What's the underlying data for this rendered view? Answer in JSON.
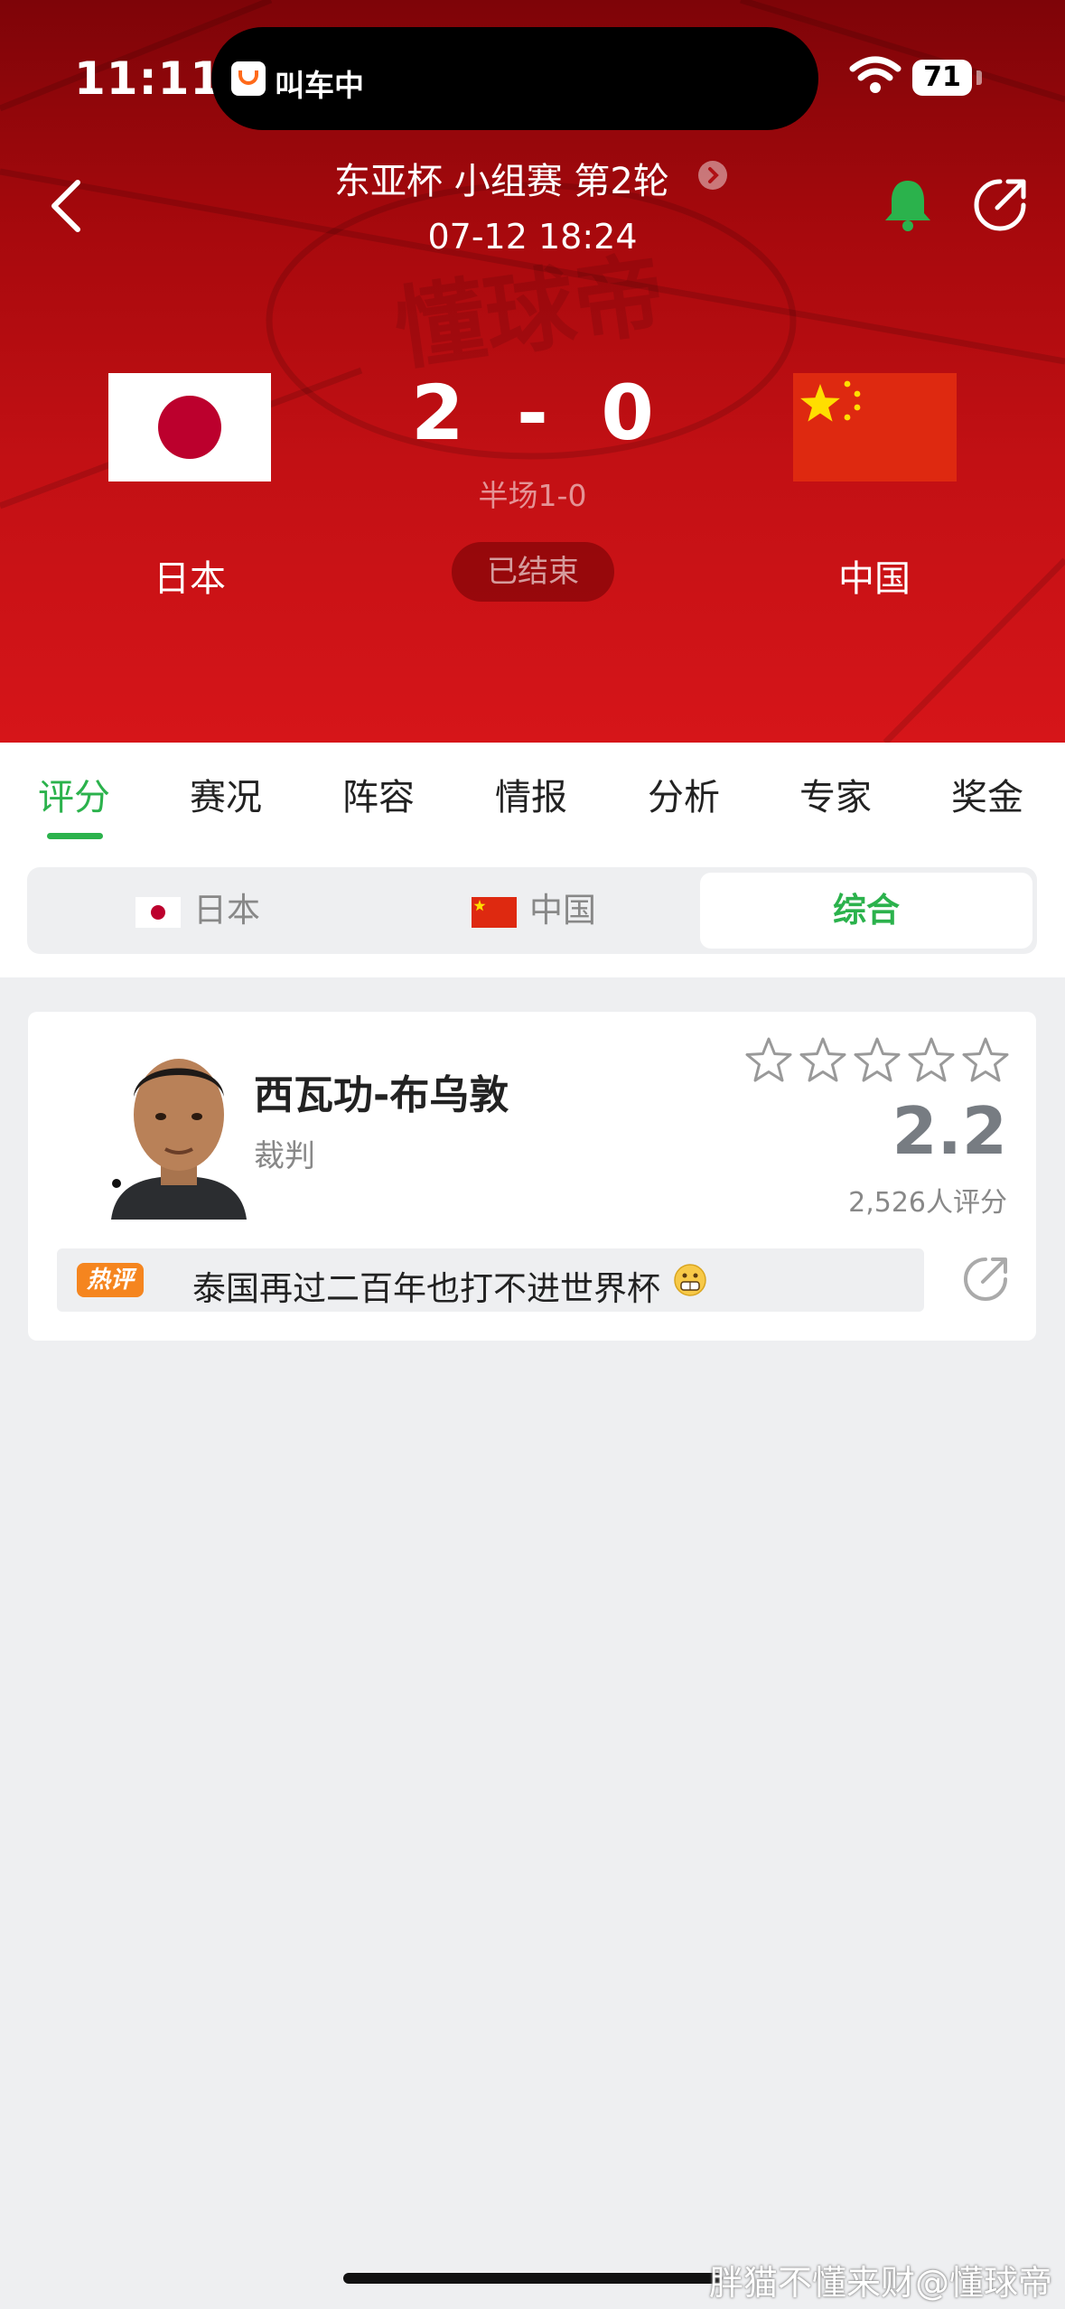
{
  "status_bar": {
    "time": "11:11",
    "live_activity_text": "叫车中",
    "battery": "71"
  },
  "header": {
    "match_title": "东亚杯 小组赛 第2轮",
    "match_datetime": "07-12 18:24",
    "home_team": "日本",
    "away_team": "中国",
    "score": "2  -  0",
    "halftime": "半场1-0",
    "status": "已结束",
    "watermark_logo": "懂球帝"
  },
  "tabs": [
    {
      "label": "评分",
      "active": true
    },
    {
      "label": "赛况"
    },
    {
      "label": "阵容"
    },
    {
      "label": "情报"
    },
    {
      "label": "分析"
    },
    {
      "label": "专家"
    },
    {
      "label": "奖金"
    }
  ],
  "segment": {
    "home": "日本",
    "away": "中国",
    "overall": "综合"
  },
  "rating_card": {
    "name": "西瓦功-布乌敦",
    "role": "裁判",
    "stars_filled": 0,
    "stars_total": 5,
    "score": "2.2",
    "count": "2,526人评分",
    "hot_badge": "热评",
    "hot_comment": "泰国再过二百年也打不进世界杯"
  },
  "watermark": "胖猫不懂来财@懂球帝",
  "colors": {
    "accent_green": "#2bb24c",
    "header_red": "#c21014",
    "badge_orange": "#f5851f"
  },
  "icons": [
    "back-chevron-icon",
    "notification-bell-icon",
    "share-icon",
    "chevron-right-icon",
    "star-outline-icon",
    "wifi-icon",
    "battery-icon"
  ]
}
